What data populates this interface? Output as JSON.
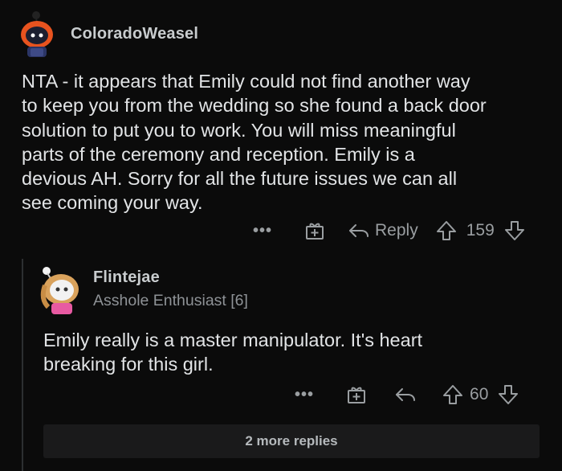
{
  "comment1": {
    "username": "ColoradoWeasel",
    "text_lines": [
      "NTA - it appears that Emily could not find another way",
      "to keep you from the wedding so she found a back door",
      "solution to put you to work. You will miss meaningful",
      "parts of the ceremony and reception.  Emily is a",
      "devious AH. Sorry for all the future issues we can all",
      "see coming your way."
    ],
    "more_label": "•••",
    "reply_label": "Reply",
    "votes": "159"
  },
  "comment2": {
    "username": "Flintejae",
    "flair": "Asshole Enthusiast [6]",
    "text_lines": [
      "Emily really is a master manipulator. It's heart",
      "breaking for this girl."
    ],
    "more_label": "•••",
    "votes": "60"
  },
  "more_replies": "2 more replies",
  "colors": {
    "background": "#0b0b0b",
    "text": "#e2e4e6",
    "muted": "#9a9ea1",
    "avatar1_accent": "#e8531f"
  }
}
